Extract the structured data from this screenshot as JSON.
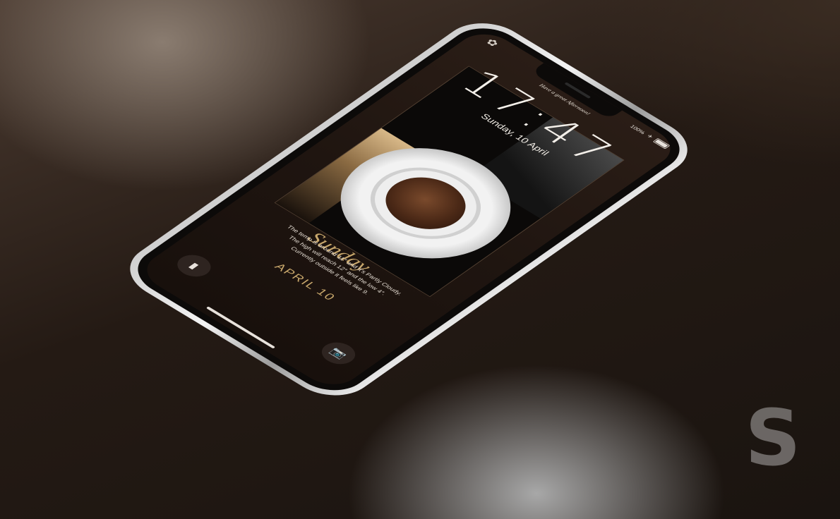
{
  "status_bar": {
    "left_icon": "lock-flower-icon",
    "battery_text": "100%",
    "icons": [
      "airplane-icon",
      "battery-icon"
    ]
  },
  "lock_screen": {
    "greeting": "Have a great Afternoon!",
    "time": "17:47",
    "date": "Sunday, 10 April",
    "script_day": "Sunday",
    "weather_lines": [
      "The temp is around 11° and it's Partly Cloudy.",
      "The high will reach 12° and the low 4°.",
      "Currently outside it feels like 9."
    ],
    "date_gold": "APRIL 10"
  },
  "quick_actions": {
    "left": {
      "icon": "flashlight-icon",
      "glyph": "▮"
    },
    "right": {
      "icon": "camera-icon",
      "glyph": "📷"
    }
  },
  "watermark": {
    "text": "S"
  }
}
